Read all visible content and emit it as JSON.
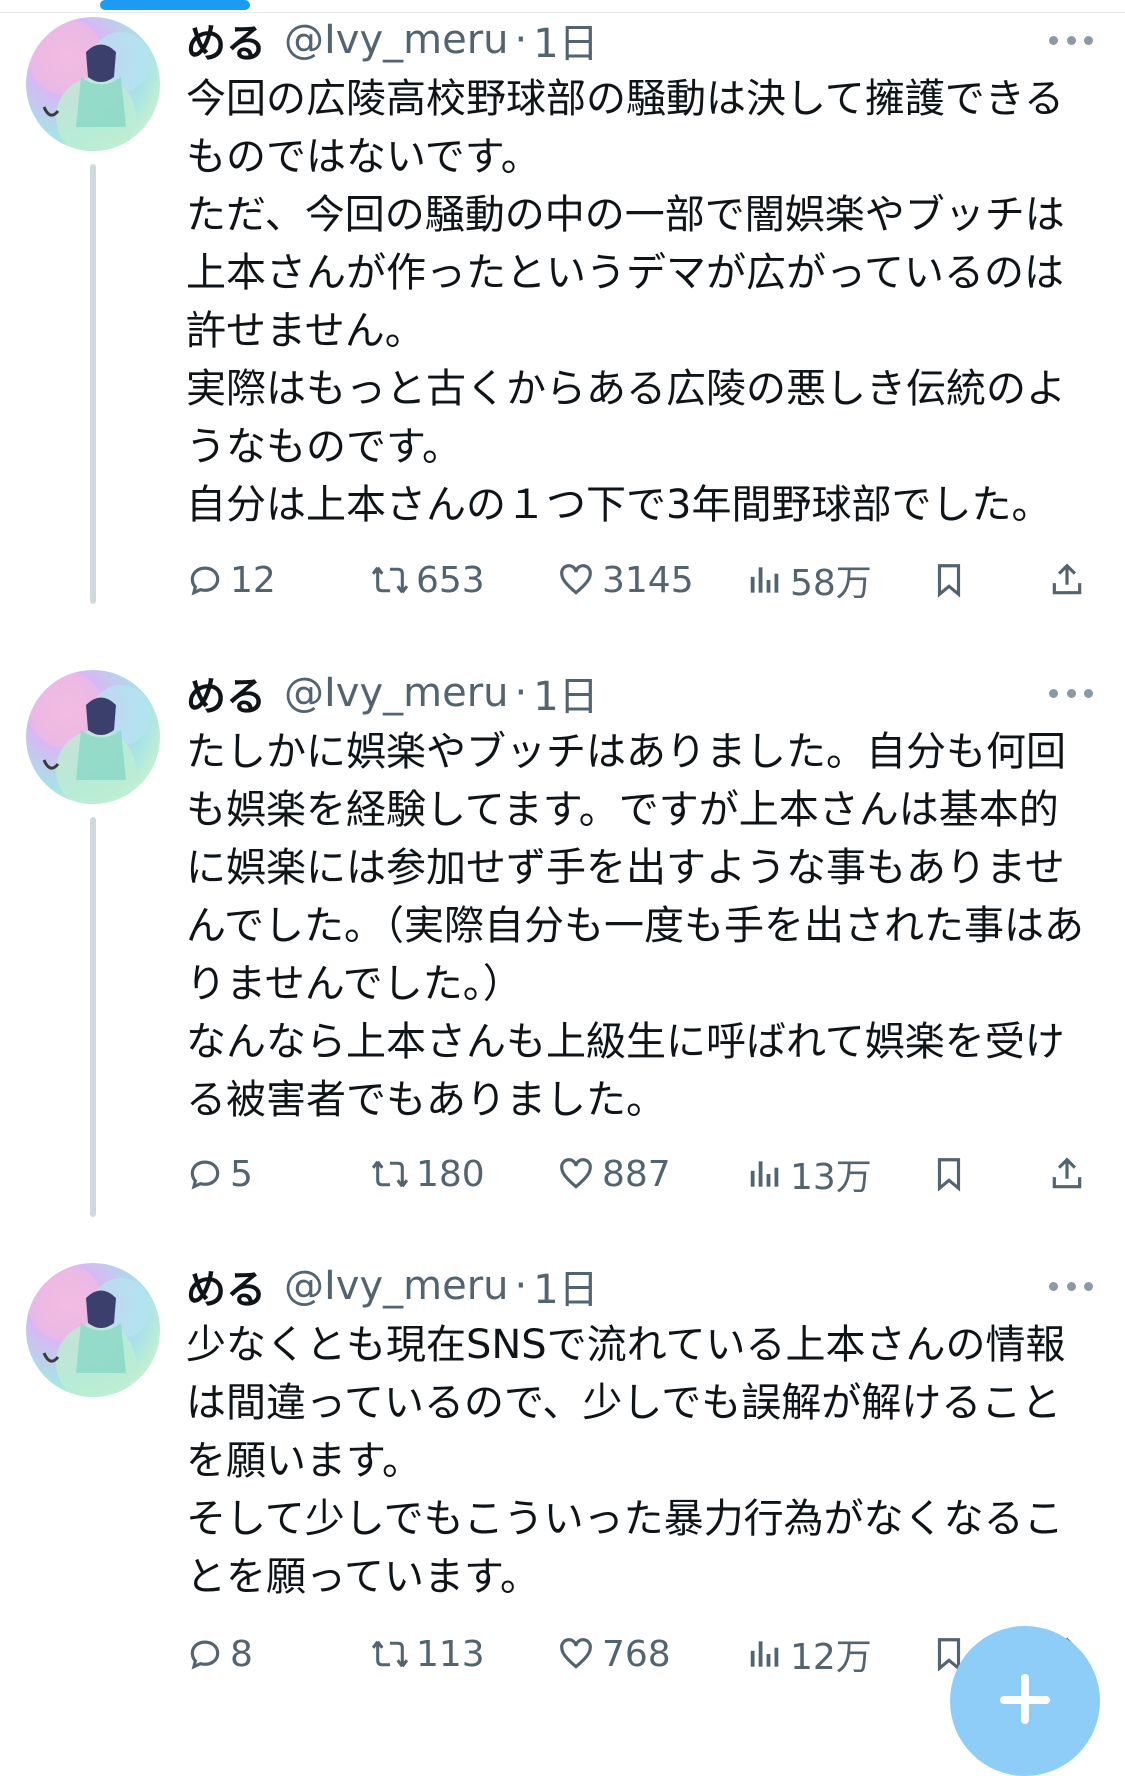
{
  "tweets": [
    {
      "name": "める",
      "handle": "@Ivy_meru",
      "separator": "·",
      "time": "1日",
      "text": "今回の広陵高校野球部の騒動は決して擁護できるものではないです。\nただ、今回の騒動の中の一部で闇娯楽やブッチは上本さんが作ったというデマが広がっているのは許せません。\n実際はもっと古くからある広陵の悪しき伝統のようなものです。\n自分は上本さんの１つ下で3年間野球部でした。",
      "replies": "12",
      "retweets": "653",
      "likes": "3145",
      "views": "58万"
    },
    {
      "name": "める",
      "handle": "@Ivy_meru",
      "separator": "·",
      "time": "1日",
      "text": "たしかに娯楽やブッチはありました。自分も何回も娯楽を経験してます。ですが上本さんは基本的に娯楽には参加せず手を出すような事もありませんでした。（実際自分も一度も手を出された事はありませんでした。）\nなんなら上本さんも上級生に呼ばれて娯楽を受ける被害者でもありました。",
      "replies": "5",
      "retweets": "180",
      "likes": "887",
      "views": "13万"
    },
    {
      "name": "める",
      "handle": "@Ivy_meru",
      "separator": "·",
      "time": "1日",
      "text": "少なくとも現在SNSで流れている上本さんの情報は間違っているので、少しでも誤解が解けることを願います。\nそして少しでもこういった暴力行為がなくなることを願っています。",
      "replies": "8",
      "retweets": "113",
      "likes": "768",
      "views": "12万"
    }
  ],
  "icons": {
    "reply": "reply-icon",
    "retweet": "retweet-icon",
    "like": "heart-icon",
    "views": "views-icon",
    "bookmark": "bookmark-icon",
    "share": "share-icon",
    "more": "more-icon",
    "compose": "compose-plus-icon"
  },
  "colors": {
    "text": "#0f1419",
    "secondary": "#536471",
    "thread_line": "#cfd9de",
    "accent": "#1d9bf0",
    "fab": "#8ecdf8"
  }
}
